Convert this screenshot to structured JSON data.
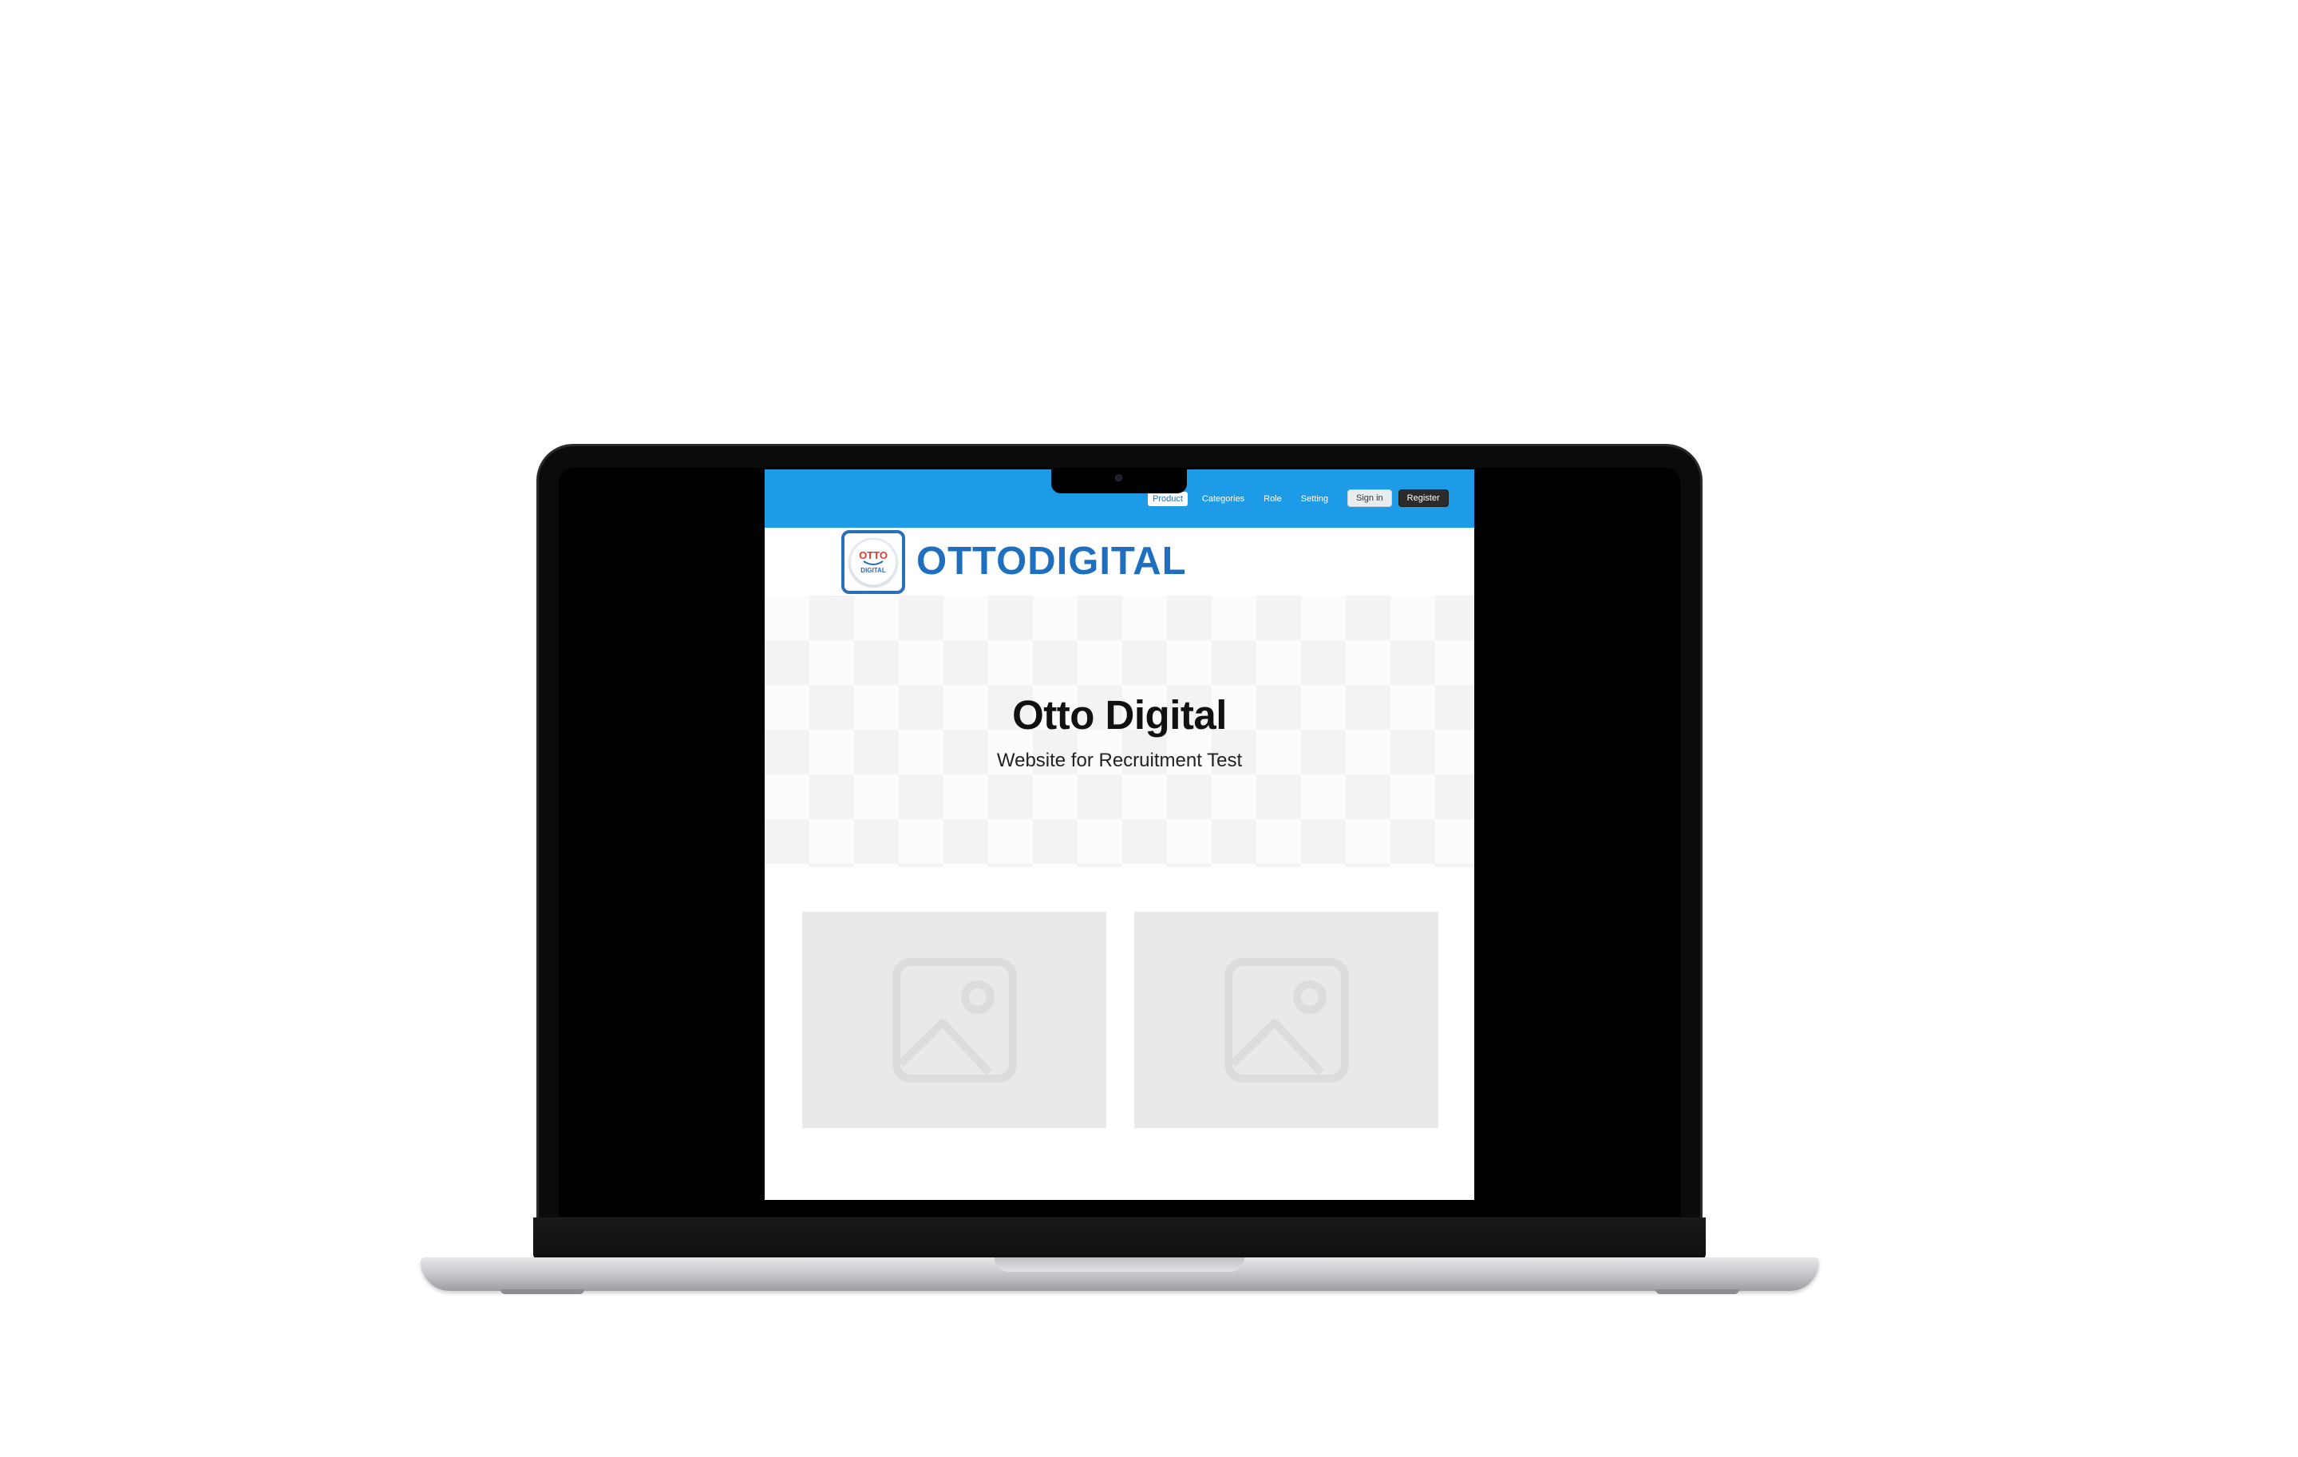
{
  "navbar": {
    "links": [
      {
        "label": "Product",
        "active": true
      },
      {
        "label": "Categories",
        "active": false
      },
      {
        "label": "Role",
        "active": false
      },
      {
        "label": "Setting",
        "active": false
      }
    ],
    "sign_in_label": "Sign in",
    "register_label": "Register",
    "color": "#1e9be6"
  },
  "logo": {
    "badge_top": "OTTO",
    "badge_bottom": "DIGITAL",
    "wordmark": "OTTODIGITAL",
    "color": "#1f6fc0"
  },
  "hero": {
    "title": "Otto Digital",
    "subtitle": "Website for Recruitment Test"
  },
  "cards": [
    {
      "icon": "image-placeholder-icon"
    },
    {
      "icon": "image-placeholder-icon"
    }
  ]
}
